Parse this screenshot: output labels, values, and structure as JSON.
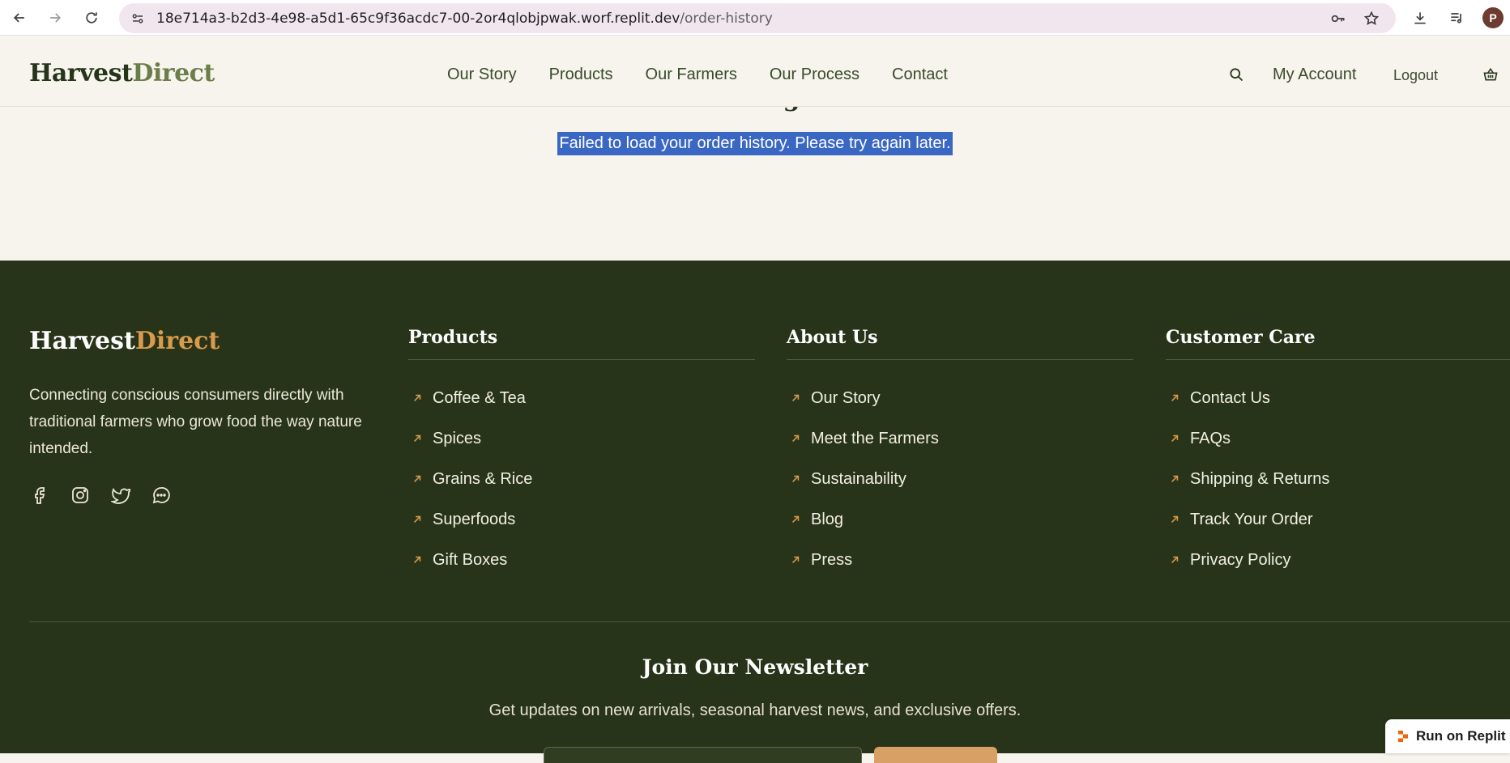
{
  "browser": {
    "url_host": "18e714a3-b2d3-4e98-a5d1-65c9f36acdc7-00-2or4qlobjpwak.worf.replit.dev",
    "url_path": "/order-history",
    "avatar_letter": "P",
    "icons": [
      "back-icon",
      "forward-icon",
      "reload-icon",
      "site-info-icon",
      "password-key-icon",
      "bookmark-star-icon",
      "download-icon",
      "media-playlist-icon"
    ]
  },
  "header": {
    "logo_part1": "Harvest",
    "logo_part2": "Direct",
    "nav": [
      {
        "label": "Our Story"
      },
      {
        "label": "Products"
      },
      {
        "label": "Our Farmers"
      },
      {
        "label": "Our Process"
      },
      {
        "label": "Contact"
      }
    ],
    "account_label": "My Account",
    "logout_label": "Logout"
  },
  "main": {
    "title": "Error Loading Orders",
    "message": "Failed to load your order history. Please try again later."
  },
  "footer": {
    "logo_part1": "Harvest",
    "logo_part2": "Direct",
    "description": "Connecting conscious consumers directly with traditional farmers who grow food the way nature intended.",
    "socials": [
      "facebook-icon",
      "instagram-icon",
      "twitter-icon",
      "chat-icon"
    ],
    "columns": [
      {
        "title": "Products",
        "links": [
          "Coffee & Tea",
          "Spices",
          "Grains & Rice",
          "Superfoods",
          "Gift Boxes"
        ]
      },
      {
        "title": "About Us",
        "links": [
          "Our Story",
          "Meet the Farmers",
          "Sustainability",
          "Blog",
          "Press"
        ]
      },
      {
        "title": "Customer Care",
        "links": [
          "Contact Us",
          "FAQs",
          "Shipping & Returns",
          "Track Your Order",
          "Privacy Policy"
        ]
      }
    ],
    "newsletter": {
      "title": "Join Our Newsletter",
      "subtitle": "Get updates on new arrivals, seasonal harvest news, and exclusive offers."
    }
  },
  "replit": {
    "label": "Run on Replit"
  },
  "colors": {
    "page_bg": "#f6f4ec",
    "footer_bg": "#283419",
    "accent": "#d89a4c",
    "selection": "#3b67c4"
  }
}
